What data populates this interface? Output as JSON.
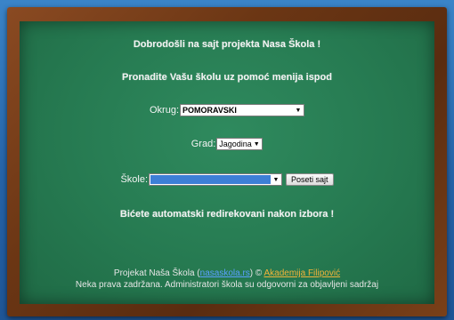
{
  "welcome_text": "Dobrodošli na sajt projekta Nasa Škola !",
  "subtitle_text": "Pronadite Vašu školu uz pomoć menija ispod",
  "okrug": {
    "label": "Okrug:",
    "selected": "POMORAVSKI"
  },
  "grad": {
    "label": "Grad:",
    "selected": "Jagodina"
  },
  "skole": {
    "label": "Škole:",
    "selected": "",
    "button_label": "Poseti sajt"
  },
  "redirect_text": "Bićete automatski redirekovani nakon izbora !",
  "footer": {
    "line1_prefix": "Projekat Naša Škola (",
    "line1_link1": "nasaskola.rs",
    "line1_mid": ") © ",
    "line1_link2": "Akademija Filipović",
    "line2": "Neka prava zadržana. Administratori škola su odgovorni za objavljeni sadržaj"
  },
  "colors": {
    "board": "#267a51",
    "frame": "#6b3614",
    "background": "#2563a8",
    "link_blue": "#5aa0ff",
    "link_orange": "#f2b43a",
    "select_highlight": "#3d7fd6"
  }
}
